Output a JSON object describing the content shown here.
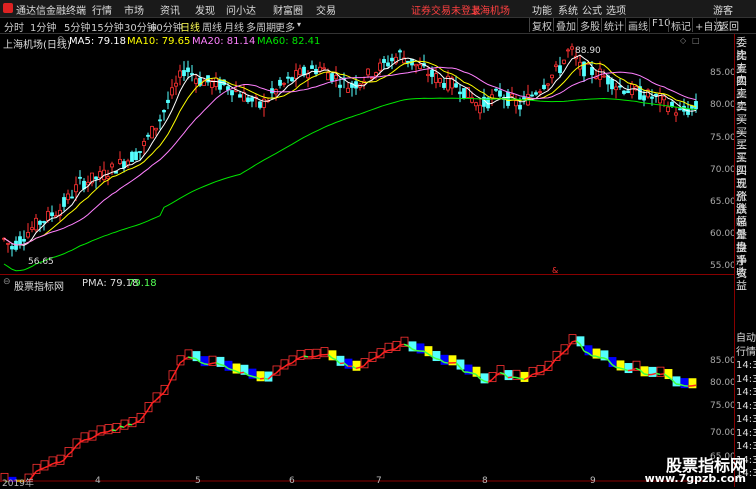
{
  "titlebar": {
    "app_name": "通达信金融终端",
    "menu": [
      "行情",
      "市场",
      "资讯",
      "发现",
      "问小达",
      "财富圈",
      "交易"
    ],
    "warning": "证券交易未登录",
    "market": "上海机场",
    "right_menu": [
      "功能",
      "系统",
      "公式",
      "选项"
    ],
    "guest": "游客"
  },
  "toolbar": {
    "periods": [
      "分时",
      "1分钟",
      "5分钟",
      "15分钟",
      "30分钟",
      "60分钟",
      "日线",
      "周线",
      "月线",
      "多周期",
      "更多"
    ],
    "active_period": "日线",
    "right_buttons": [
      "复权",
      "叠加",
      "多股",
      "统计",
      "画线",
      "F10",
      "标记",
      "+自选",
      "返回"
    ]
  },
  "main_chart": {
    "title": "上海机场(日线)",
    "ma5_label": "MA5: 79.18",
    "ma10_label": "MA10: 79.65",
    "ma20_label": "MA20: 81.14",
    "ma60_label": "MA60: 82.41",
    "high_label": "88.90",
    "low_label": "56.65",
    "y_ticks": [
      "85.00",
      "80.00",
      "75.00",
      "70.00",
      "65.00",
      "60.00",
      "55.00"
    ],
    "marker": "&"
  },
  "sub_chart": {
    "title": "股票指标网",
    "pma_label": "PMA: 79.18",
    "pma_value": "79.18",
    "y_ticks": [
      "85.00",
      "80.00",
      "75.00",
      "70.00",
      "65.00"
    ]
  },
  "x_axis": {
    "labels": [
      "2019年",
      "4",
      "5",
      "6",
      "7",
      "8",
      "9"
    ]
  },
  "right_panel": {
    "items": [
      "委比",
      "卖五",
      "卖四",
      "卖三",
      "卖二",
      "卖一",
      "买一",
      "买二",
      "买三",
      "买四",
      "买五",
      "现价",
      "涨跌",
      "涨幅",
      "总量",
      "外盘",
      "换手",
      "净资",
      "收益"
    ],
    "lower_items": [
      "自动",
      "行情",
      "14:30",
      "14:30",
      "14:30",
      "14:30",
      "14:30",
      "14:30",
      "14:31",
      "14:31",
      "14:31"
    ]
  },
  "watermark": {
    "name": "股票指标网",
    "url": "www.7gpzb.com"
  },
  "colors": {
    "up": "#ff3232",
    "down": "#54ffff",
    "ma5": "#ffffff",
    "ma10": "#ffff00",
    "ma20": "#ff80ff",
    "ma60": "#00e600",
    "warning": "#ff4040"
  }
}
